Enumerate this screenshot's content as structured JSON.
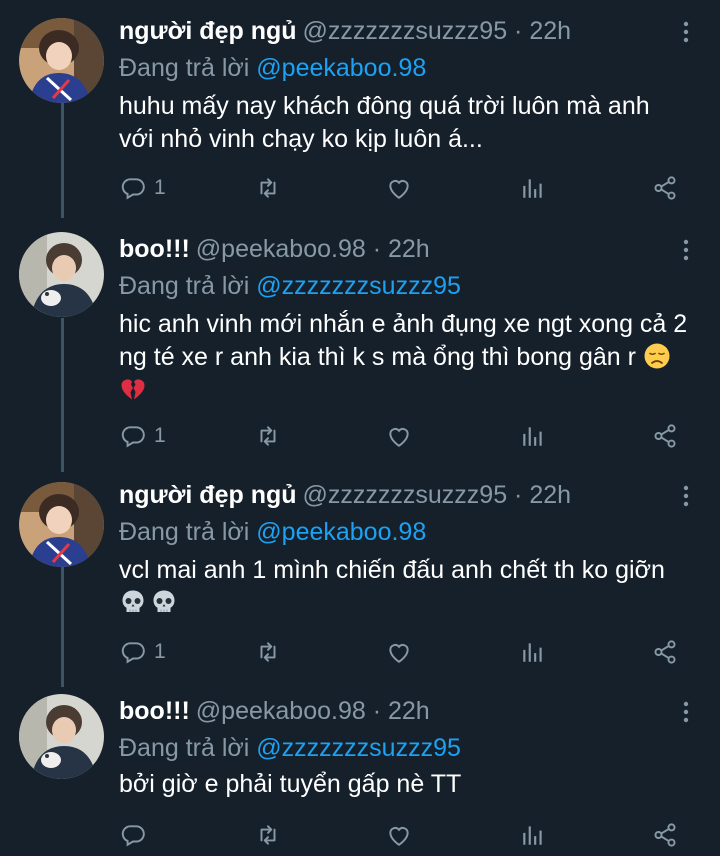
{
  "tweets": [
    {
      "name": "người đẹp ngủ",
      "handle": "@zzzzzzzsuzzz95 · 22h",
      "reply_prefix": "Đang trả lời ",
      "reply_to": "@peekaboo.98",
      "text": "huhu mấy nay khách đông quá trời luôn mà anh với nhỏ vinh chạy ko kịp luôn á...",
      "reply_count": "1",
      "avatar": "girl-avatar"
    },
    {
      "name": "boo!!!",
      "handle": "@peekaboo.98 · 22h",
      "reply_prefix": "Đang trả lời ",
      "reply_to": "@zzzzzzzsuzzz95",
      "text": "hic anh vinh mới nhắn e ảnh đụng xe ngt xong cả 2 ng té xe r anh kia thì k s mà ổng thì bong gân r",
      "emojis": [
        "disappointed-face-emoji",
        "broken-heart-emoji"
      ],
      "reply_count": "1",
      "avatar": "boy-avatar"
    },
    {
      "name": "người đẹp ngủ",
      "handle": "@zzzzzzzsuzzz95 · 22h",
      "reply_prefix": "Đang trả lời ",
      "reply_to": "@peekaboo.98",
      "text": "vcl mai anh 1 mình chiến đấu anh chết th ko giỡn",
      "emojis": [
        "skull-emoji",
        "skull-emoji"
      ],
      "reply_count": "1",
      "avatar": "girl-avatar"
    },
    {
      "name": "boo!!!",
      "handle": "@peekaboo.98 · 22h",
      "reply_prefix": "Đang trả lời ",
      "reply_to": "@zzzzzzzsuzzz95",
      "text": "bởi giờ e phải tuyển gấp nè TT",
      "reply_count": "",
      "avatar": "boy-avatar"
    }
  ],
  "icons": {
    "reply": "reply-icon",
    "retweet": "retweet-icon",
    "like": "like-icon",
    "analytics": "analytics-icon",
    "share": "share-icon",
    "more": "more-vertical-icon"
  },
  "colors": {
    "background": "#15202b",
    "secondary_text": "#8899a6",
    "link": "#1da1f2",
    "thread_line": "#3d5466"
  }
}
